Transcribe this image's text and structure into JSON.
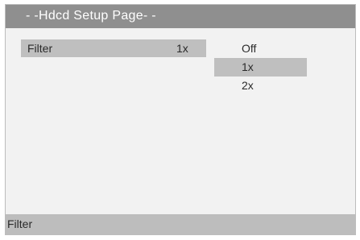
{
  "title": "- -Hdcd Setup Page- -",
  "setting": {
    "label": "Filter",
    "value": "1x"
  },
  "options": [
    {
      "label": "Off",
      "selected": false
    },
    {
      "label": "1x",
      "selected": true
    },
    {
      "label": "2x",
      "selected": false
    }
  ],
  "status": "Filter",
  "colors": {
    "title_bar": "#8f8f8f",
    "highlight": "#bfbfbf",
    "panel": "#f2f2f2",
    "status_bar": "#bdbdbd"
  }
}
